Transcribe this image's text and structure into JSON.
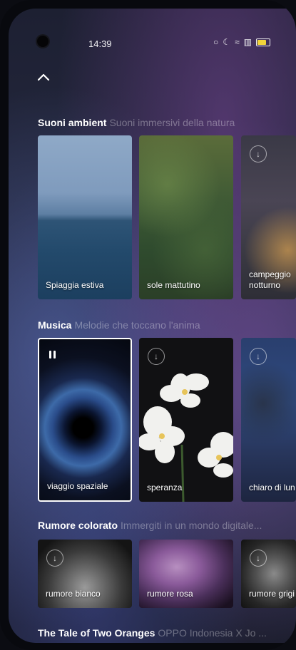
{
  "status": {
    "time": "14:39"
  },
  "sections": {
    "ambient": {
      "title": "Suoni ambient",
      "subtitle": "Suoni immersivi della natura",
      "cards": [
        {
          "label": "Spiaggia estiva"
        },
        {
          "label": "sole mattutino"
        },
        {
          "label": "campeggio notturno"
        }
      ]
    },
    "music": {
      "title": "Musica",
      "subtitle": "Melodie che toccano l'anima",
      "cards": [
        {
          "label": "viaggio spaziale"
        },
        {
          "label": "speranza"
        },
        {
          "label": "chiaro di lun"
        }
      ]
    },
    "noise": {
      "title": "Rumore colorato",
      "subtitle": "Immergiti in un mondo digitale...",
      "cards": [
        {
          "label": "rumore bianco"
        },
        {
          "label": "rumore rosa"
        },
        {
          "label": "rumore grigi"
        }
      ]
    },
    "story": {
      "title": "The Tale of Two Oranges",
      "subtitle": "OPPO Indonesia X Jo ..."
    }
  },
  "icons": {
    "collapse": "chevron-up-icon",
    "download": "download-icon",
    "playing": "pause-icon"
  },
  "colors": {
    "selected_border": "#ffffff"
  }
}
